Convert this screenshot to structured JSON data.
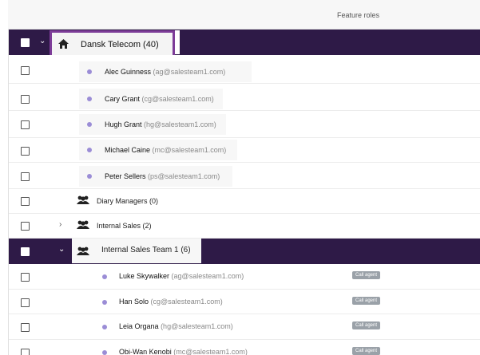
{
  "header": {
    "feature_roles": "Feature roles"
  },
  "org": {
    "title": "Dansk Telecom  (40)"
  },
  "members_top": [
    {
      "name": "Alec Guinness",
      "email": "(ag@salesteam1.com)"
    },
    {
      "name": "Cary Grant",
      "email": "(cg@salesteam1.com)"
    },
    {
      "name": "Hugh Grant",
      "email": "(hg@salesteam1.com)"
    },
    {
      "name": "Michael Caine",
      "email": "(mc@salesteam1.com)"
    },
    {
      "name": "Peter Sellers",
      "email": "(ps@salesteam1.com)"
    }
  ],
  "groups": {
    "diary_managers": "Diary Managers  (0)",
    "internal_sales": "Internal Sales  (2)",
    "team1": "Internal Sales Team 1  (6)"
  },
  "members_team": [
    {
      "name": "Luke Skywalker",
      "email": "(ag@salesteam1.com)",
      "badge": "Call agent"
    },
    {
      "name": "Han Solo",
      "email": "(cg@salesteam1.com)",
      "badge": "Call agent"
    },
    {
      "name": "Leia Organa",
      "email": "(hg@salesteam1.com)",
      "badge": "Call agent"
    },
    {
      "name": "Obi-Wan Kenobi",
      "email": "(mc@salesteam1.com)",
      "badge": "Call agent"
    }
  ],
  "icons": {
    "home": "home-icon",
    "group": "group-icon",
    "chevron_down": "chevron-down-icon",
    "chevron_right": "chevron-right-icon"
  },
  "colors": {
    "dark_row": "#2e1a47",
    "highlight": "#7d3c98",
    "dot": "#9b8dd6",
    "badge": "#9aa1a8"
  }
}
